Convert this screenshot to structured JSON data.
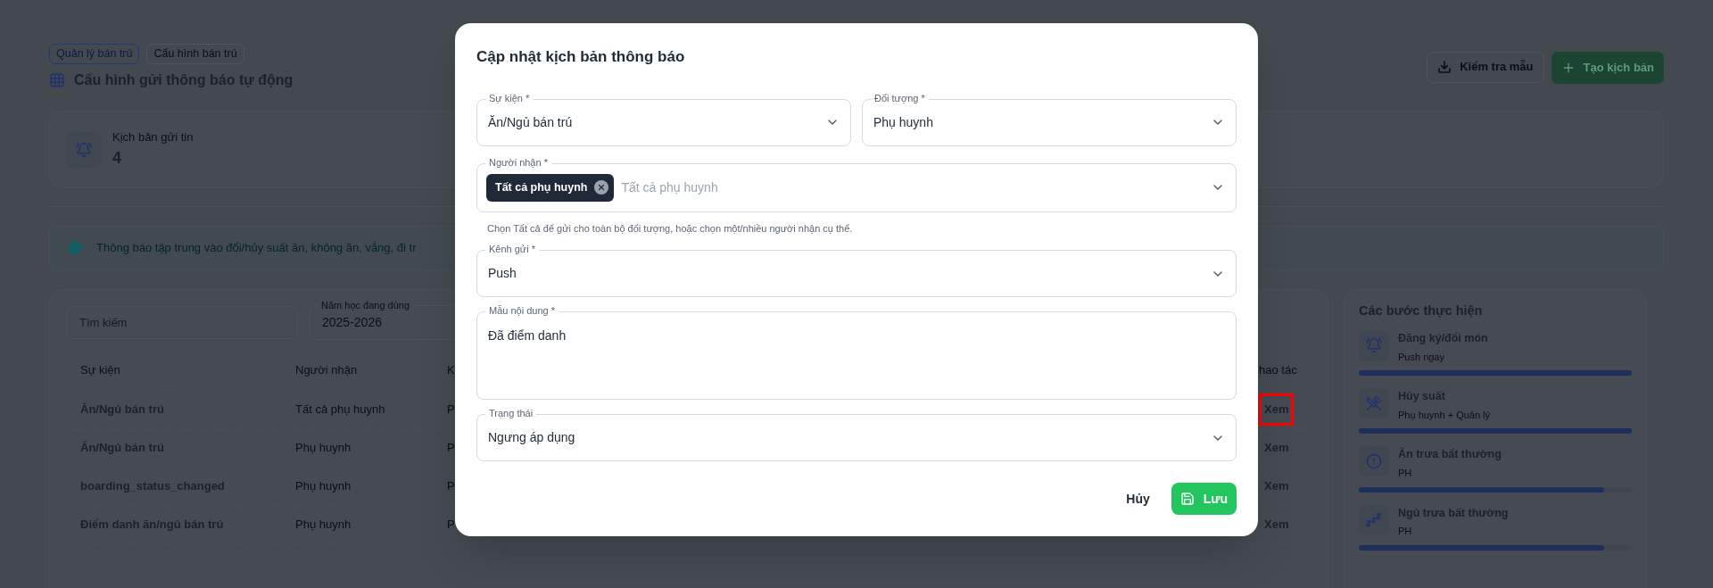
{
  "breadcrumbs": [
    {
      "label": "Quản lý bán trú",
      "selected": true
    },
    {
      "label": "Cấu hình bán trú",
      "selected": false
    }
  ],
  "page_title": "Cấu hình gửi thông báo tự động",
  "actions": [
    {
      "label": "Kiểm tra mẫu",
      "kind": "outline"
    },
    {
      "label": "Tạo kịch bản",
      "kind": "primary"
    }
  ],
  "stats": [
    {
      "label": "Kịch bản gửi tin",
      "value": "4"
    }
  ],
  "info_banner": "Thông báo tập trung vào đổi/hủy suất ăn, không ăn, vắng, đi tr",
  "filters": {
    "search": {
      "placeholder": "Tìm kiếm"
    },
    "school_year": {
      "label": "Năm học đang dùng",
      "value": "2025-2026"
    }
  },
  "table": {
    "columns": [
      "Sự kiện",
      "Người nhận",
      "K",
      "hao tác"
    ],
    "rows": [
      {
        "cells": [
          "Ăn/Ngủ bán trú",
          "Tất cả phụ huynh",
          "P"
        ],
        "action": "Xem",
        "highlighted": true
      },
      {
        "cells": [
          "Ăn/Ngủ bán trú",
          "Phụ huynh",
          "P"
        ],
        "action": "Xem",
        "highlighted": false
      },
      {
        "cells": [
          "boarding_status_changed",
          "Phụ huynh",
          "P"
        ],
        "action": "Xem",
        "highlighted": false
      },
      {
        "cells": [
          "Điểm danh ăn/ngủ bán trú",
          "Phụ huynh",
          "P"
        ],
        "action": "Xem",
        "highlighted": false
      }
    ]
  },
  "steps": {
    "title": "Các bước thực hiện",
    "items": [
      {
        "kind": "bell",
        "title": "Đăng ký/đổi món",
        "subtitle": "Push ngay",
        "level": 1
      },
      {
        "kind": "cancel",
        "title": "Hủy suất",
        "subtitle": "Phụ huynh + Quản lý",
        "level": 1
      },
      {
        "kind": "alert",
        "title": "Ăn trưa bất thường",
        "subtitle": "PH",
        "level": 0.9
      },
      {
        "kind": "sleep",
        "title": "Ngủ trưa bất thường",
        "subtitle": "PH",
        "level": 0.9
      }
    ]
  },
  "dialog": {
    "title": "Cập nhật kịch bản thông báo",
    "fields": [
      {
        "kind": "select",
        "label": "Sự kiện *",
        "value": "Ăn/Ngủ bán trú"
      },
      {
        "kind": "select",
        "label": "Đối tượng *",
        "value": "Phụ huynh"
      },
      {
        "kind": "multiselect",
        "label": "Người nhận *",
        "chips": [
          "Tất cả phụ huynh"
        ],
        "placeholder": "Tất cả phụ huynh",
        "hint": "Chọn Tất cả để gửi cho toàn bộ đối tượng, hoặc chọn một/nhiều người nhận cụ thể."
      },
      {
        "kind": "select",
        "label": "Kênh gửi *",
        "value": "Push"
      },
      {
        "kind": "textarea",
        "label": "Mẫu nội dung *",
        "value": "Đã điểm danh"
      },
      {
        "kind": "select",
        "label": "Trạng thái",
        "value": "Ngưng áp dụng"
      }
    ],
    "cancel": "Hủy",
    "save": "Lưu"
  }
}
